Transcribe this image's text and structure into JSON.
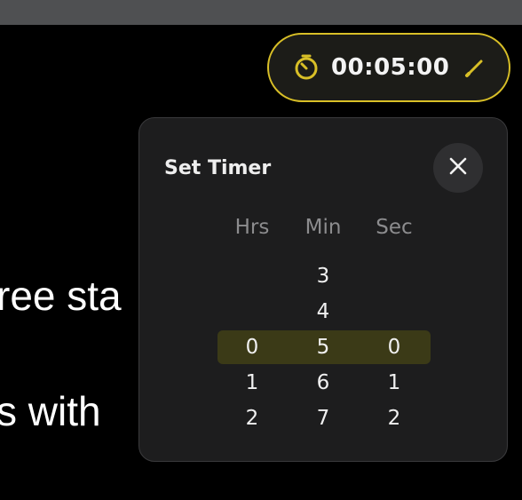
{
  "background": {
    "line1": "ree sta",
    "line2": "s with"
  },
  "timer": {
    "display": "00:05:00",
    "icon": "timer-clock-icon",
    "edit_icon": "pencil-icon",
    "accent_color": "#d8bf27"
  },
  "popup": {
    "title": "Set Timer",
    "close_icon": "close-icon",
    "columns": {
      "hours": {
        "header": "Hrs",
        "items": [
          "",
          "",
          "0",
          "1",
          "2"
        ],
        "selected": "0"
      },
      "minutes": {
        "header": "Min",
        "items": [
          "3",
          "4",
          "5",
          "6",
          "7"
        ],
        "selected": "5"
      },
      "seconds": {
        "header": "Sec",
        "items": [
          "",
          "",
          "0",
          "1",
          "2"
        ],
        "selected": "0"
      }
    }
  }
}
